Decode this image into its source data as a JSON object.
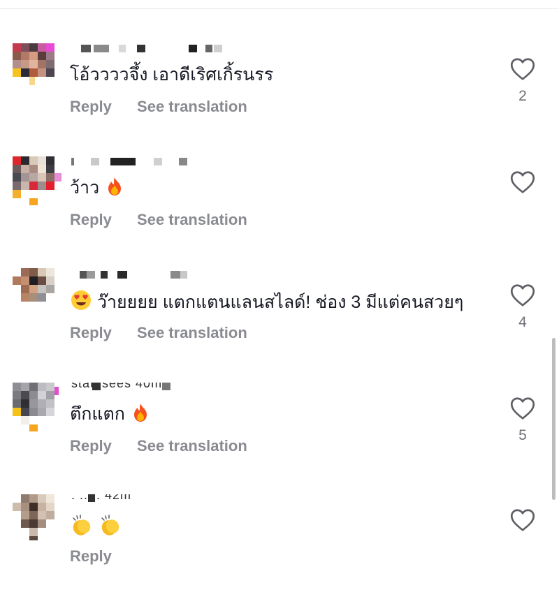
{
  "comments": [
    {
      "username": "",
      "text": "โอ้ววววจึ้ง เอาดีเริศเกิ้รนรร",
      "lead_emoji": "",
      "trail_emoji": "",
      "reply_label": "Reply",
      "translate_label": "See translation",
      "like_count": "2"
    },
    {
      "username": "",
      "text": "ว้าว",
      "lead_emoji": "",
      "trail_emoji": "fire-emoji",
      "reply_label": "Reply",
      "translate_label": "See translation",
      "like_count": ""
    },
    {
      "username": "",
      "text": "ว๊ายยยย แตกแตนแลนสไลด์! ช่อง 3 มีแต่คนสวยๆ",
      "lead_emoji": "heart-eyes-emoji",
      "trail_emoji": "",
      "reply_label": "Reply",
      "translate_label": "See translation",
      "like_count": "4"
    },
    {
      "username": "",
      "text": "ตึกแตก",
      "lead_emoji": "",
      "trail_emoji": "fire-emoji",
      "reply_label": "Reply",
      "translate_label": "See translation",
      "like_count": "5"
    },
    {
      "username": "",
      "text": "",
      "lead_emoji": "clapping-hands-emoji",
      "trail_emoji": "",
      "reply_label": "Reply",
      "translate_label": "",
      "like_count": ""
    }
  ],
  "colors": {
    "text": "#161823",
    "secondary": "#8a8b91",
    "like_outline": "#5f5f66",
    "scrollbar": "#bcbcbc"
  }
}
